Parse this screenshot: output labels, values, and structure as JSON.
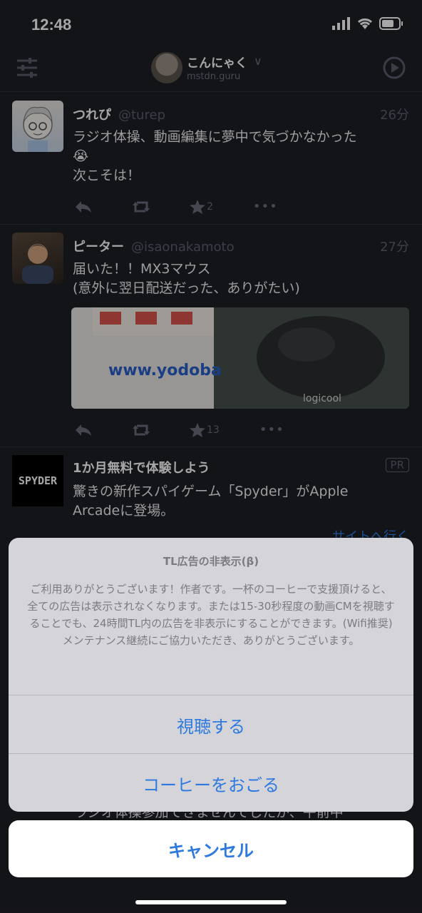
{
  "status_bar": {
    "time": "12:48"
  },
  "header": {
    "account_name": "こんにゃく",
    "server": "mstdn.guru"
  },
  "posts": [
    {
      "name": "つれぴ",
      "handle": "@turep",
      "time": "26分",
      "text_line1": "ラジオ体操、動画編集に夢中で気づかなかった",
      "emoji": "😭",
      "text_line2": "次こそは！",
      "fav_count": "2"
    },
    {
      "name": "ピーター",
      "handle": "@isaonakamoto",
      "time": "27分",
      "text_line1": "届いた！！MX3マウス",
      "text_line2": "(意外に翌日配送だった、ありがたい)",
      "media_text": "www.yodoba",
      "media_brand": "logicool",
      "fav_count": "13"
    },
    {
      "avatar_text": "SPYDER",
      "title": "1か月無料で体験しよう",
      "badge": "PR",
      "text_line1": "驚きの新作スパイゲーム「Spyder」がApple",
      "text_line2": "Arcadeに登場。",
      "link": "サイトへ行く"
    }
  ],
  "behind_text": "ラジオ体操参加できませんでしたが、午前中",
  "dialog": {
    "title": "TL広告の非表示(β)",
    "message": "ご利用ありがとうございます！作者です。一杯のコーヒーで支援頂けると、全ての広告は表示されなくなります。または15-30秒程度の動画CMを視聴することでも、24時間TL内の広告を非表示にすることができます。(Wifi推奨) メンテナンス継続にご協力いただき、ありがとうございます。",
    "watch_label": "視聴する",
    "coffee_label": "コーヒーをおごる",
    "cancel_label": "キャンセル"
  },
  "colors": {
    "background": "#1e1f26",
    "accent": "#2d79e0"
  }
}
